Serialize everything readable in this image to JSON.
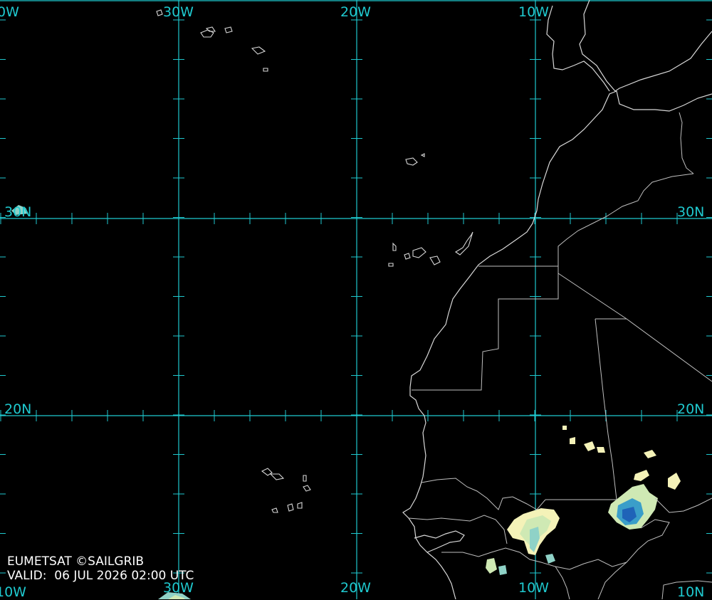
{
  "map": {
    "credit": "EUMETSAT ©SAILGRIB",
    "valid_label": "VALID:",
    "valid_time": "06 JUL 2026 02:00 UTC",
    "gridline_color": "#1fc9cf",
    "coastline_color": "#d8d8d8",
    "longitude_labels_top": [
      "0W",
      "30W",
      "20W",
      "10W"
    ],
    "longitude_labels_bottom": [
      "10W",
      "30W",
      "20W",
      "10W",
      "10N"
    ],
    "latitude_labels_left": [
      "30N",
      "20N"
    ],
    "latitude_labels_right": [
      "30N",
      "20N"
    ],
    "precip_colors": [
      "#f4f2b8",
      "#cfe9b4",
      "#8fd2c7",
      "#3a9ec9",
      "#1f63b8"
    ]
  }
}
